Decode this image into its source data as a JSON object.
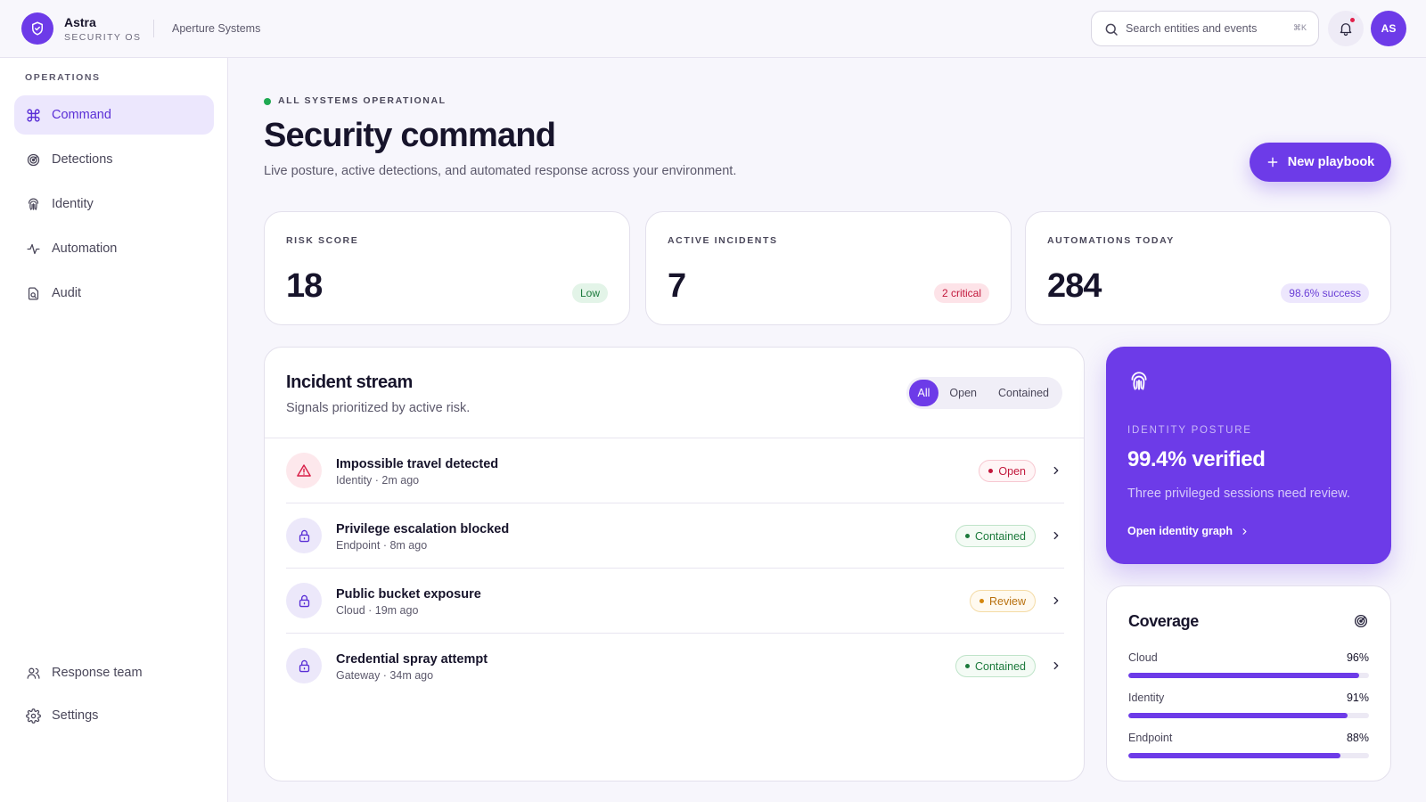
{
  "app": {
    "name": "Astra",
    "subtitle": "SECURITY OS",
    "organization": "Aperture Systems"
  },
  "header": {
    "search_placeholder": "Search entities and events",
    "search_shortcut": "⌘K",
    "avatar_initials": "AS",
    "accent_color": "#6d3be8"
  },
  "sidebar": {
    "heading": "OPERATIONS",
    "items": [
      {
        "label": "Command",
        "icon": "command-icon",
        "active": true
      },
      {
        "label": "Detections",
        "icon": "radar-icon",
        "active": false
      },
      {
        "label": "Identity",
        "icon": "fingerprint-icon",
        "active": false
      },
      {
        "label": "Automation",
        "icon": "activity-icon",
        "active": false
      },
      {
        "label": "Audit",
        "icon": "audit-file-icon",
        "active": false
      }
    ],
    "footer_items": [
      {
        "label": "Response team",
        "icon": "users-icon"
      },
      {
        "label": "Settings",
        "icon": "gear-icon"
      }
    ]
  },
  "main": {
    "status": "ALL SYSTEMS OPERATIONAL",
    "title": "Security command",
    "subtitle": "Live posture, active detections, and automated response across your environment.",
    "new_button": "New playbook"
  },
  "stats": [
    {
      "label": "RISK SCORE",
      "value": "18",
      "badge": "Low",
      "badge_color": "green"
    },
    {
      "label": "ACTIVE INCIDENTS",
      "value": "7",
      "badge": "2 critical",
      "badge_color": "red"
    },
    {
      "label": "AUTOMATIONS TODAY",
      "value": "284",
      "badge": "98.6% success",
      "badge_color": "purple"
    }
  ],
  "stream": {
    "title": "Incident stream",
    "subtitle": "Signals prioritized by active risk.",
    "filters": [
      "All",
      "Open",
      "Contained"
    ],
    "active_filter": "All",
    "incidents": [
      {
        "title": "Impossible travel detected",
        "meta": "Identity · 2m ago",
        "status": "Open",
        "icon": "warning-triangle-icon"
      },
      {
        "title": "Privilege escalation blocked",
        "meta": "Endpoint · 8m ago",
        "status": "Contained",
        "icon": "lock-icon"
      },
      {
        "title": "Public bucket exposure",
        "meta": "Cloud · 19m ago",
        "status": "Review",
        "icon": "lock-icon"
      },
      {
        "title": "Credential spray attempt",
        "meta": "Gateway · 34m ago",
        "status": "Contained",
        "icon": "lock-icon"
      }
    ]
  },
  "identity": {
    "label": "IDENTITY POSTURE",
    "value": "99.4% verified",
    "description": "Three privileged sessions need review.",
    "link": "Open identity graph"
  },
  "coverage": {
    "title": "Coverage",
    "items": [
      {
        "name": "Cloud",
        "percent": "96%",
        "value": 0.96
      },
      {
        "name": "Identity",
        "percent": "91%",
        "value": 0.91
      },
      {
        "name": "Endpoint",
        "percent": "88%",
        "value": 0.88
      }
    ]
  }
}
